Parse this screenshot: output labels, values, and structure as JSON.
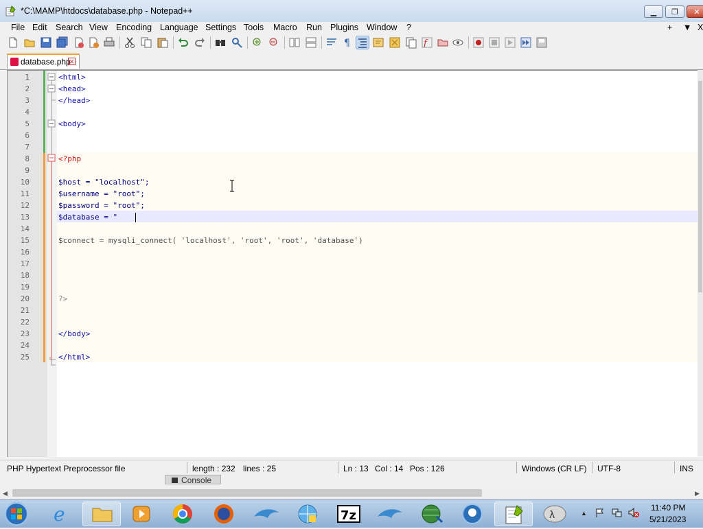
{
  "window": {
    "title": "*C:\\MAMP\\htdocs\\database.php - Notepad++"
  },
  "menu": {
    "items": [
      "File",
      "Edit",
      "Search",
      "View",
      "Encoding",
      "Language",
      "Settings",
      "Tools",
      "Macro",
      "Run",
      "Plugins",
      "Window",
      "?"
    ],
    "right_plus": "+",
    "right_down": "▼",
    "right_x": "X"
  },
  "tab": {
    "label": "database.php"
  },
  "editor": {
    "line_numbers": [
      "1",
      "2",
      "3",
      "4",
      "5",
      "6",
      "7",
      "8",
      "9",
      "10",
      "11",
      "12",
      "13",
      "14",
      "15",
      "16",
      "17",
      "18",
      "19",
      "20",
      "21",
      "22",
      "23",
      "24",
      "25"
    ],
    "lines": [
      "<html>",
      "<head>",
      "</head>",
      "",
      "<body>",
      "",
      "",
      "<?php",
      "",
      "$host = \"localhost\";",
      "$username = \"root\";",
      "$password = \"root\";",
      "$database = \"",
      "",
      "$connect = mysqli_connect( 'localhost', 'root', 'root', 'database')",
      "",
      "",
      "",
      "",
      "?>",
      "",
      "",
      "</body>",
      "",
      "</html>"
    ],
    "current_line": 13
  },
  "status": {
    "file_type": "PHP Hypertext Preprocessor file",
    "length": "length : 232",
    "lines": "lines : 25",
    "ln": "Ln : 13",
    "col": "Col : 14",
    "pos": "Pos : 126",
    "eol": "Windows (CR LF)",
    "encoding": "UTF-8",
    "mode": "INS"
  },
  "console": {
    "label": "Console"
  },
  "taskbar": {
    "time": "11:40 PM",
    "date": "5/21/2023",
    "icons": [
      "windows-start-icon",
      "internet-explorer-icon",
      "file-explorer-icon",
      "media-player-icon",
      "chrome-icon",
      "firefox-icon",
      "dolphin-icon",
      "network-globe-icon",
      "7zip-icon",
      "dolphin-icon-2",
      "globe-download-icon",
      "blue-circle-app-icon",
      "notepad-plus-plus-icon",
      "xampp-icon"
    ]
  },
  "colors": {
    "tag": "#1010b0",
    "php": "#d01010",
    "string": "#808080",
    "current_line": "#e8e8ff"
  }
}
